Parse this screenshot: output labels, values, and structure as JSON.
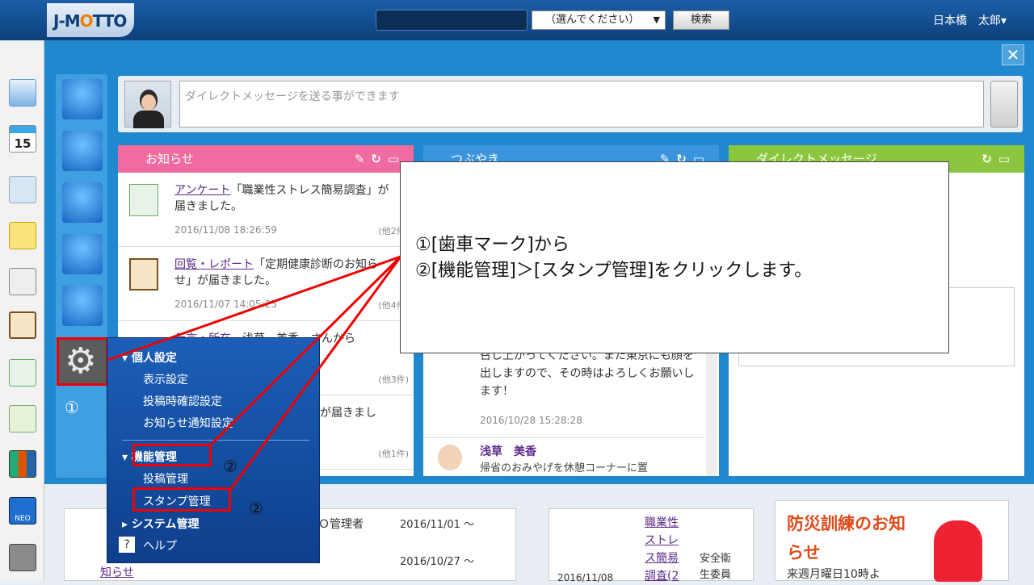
{
  "header": {
    "logo": "J-MOTTO",
    "select_value": "（選んでください）",
    "search_button": "検索",
    "user": "日本橋　太郎▾"
  },
  "messagebar": {
    "placeholder": "ダイレクトメッセージを送る事ができます"
  },
  "cards": {
    "news": {
      "title": "お知らせ",
      "color": "#f06ca0",
      "items": [
        {
          "link": "アンケート",
          "text": "「職業性ストレス簡易調査」が届きました。",
          "date": "2016/11/08 18:26:59",
          "count": "(他2件)"
        },
        {
          "link": "回覧・レポート",
          "text": "「定期健康診断のお知らせ」が届きました。",
          "date": "2016/11/07 14:05:25",
          "count": "(他4件)"
        },
        {
          "link": "伝言・所在",
          "text": "浅草　美香　さんから",
          "date": "",
          "count": "(他3件)"
        },
        {
          "link": "",
          "text": "が届きまし",
          "date": "",
          "count": "(他1件)"
        }
      ]
    },
    "tweet": {
      "title": "つぶやき",
      "color": "#3b95de",
      "body": "召し上がってください。また東京にも顔を出しますので、その時はよろしくお願いします！",
      "date": "2016/10/28 15:28:28",
      "user": "浅草　美香",
      "snippet": "帰省のおみやげを休憩コーナーに置"
    },
    "dm": {
      "title": "ダイレクトメッセージ",
      "color": "#8cc63f"
    }
  },
  "menu": {
    "personal": "個人設定",
    "display": "表示設定",
    "confirm": "投稿時確認設定",
    "notify": "お知らせ通知設定",
    "function": "機能管理",
    "post": "投稿管理",
    "stamp": "スタンプ管理",
    "system": "システム管理",
    "help": "ヘルプ"
  },
  "callout": {
    "line1": "①[歯車マーク]から",
    "line2": "②[機能管理]＞[スタンプ管理]をクリックします。"
  },
  "markers": {
    "c1": "①",
    "c2": "②"
  },
  "bottom": {
    "admin": "ＴＯ管理者",
    "date1": "2016/11/01 ～",
    "date2": "2016/10/27 ～",
    "notice": "知らせ",
    "survey": "職業性ストレス簡易調査(2",
    "survey_side": "安全衛生委員",
    "survey_date": "2016/11/08",
    "disaster_title": "防災訓練のお知らせ",
    "disaster_sub": "来週月曜日10時よ"
  }
}
